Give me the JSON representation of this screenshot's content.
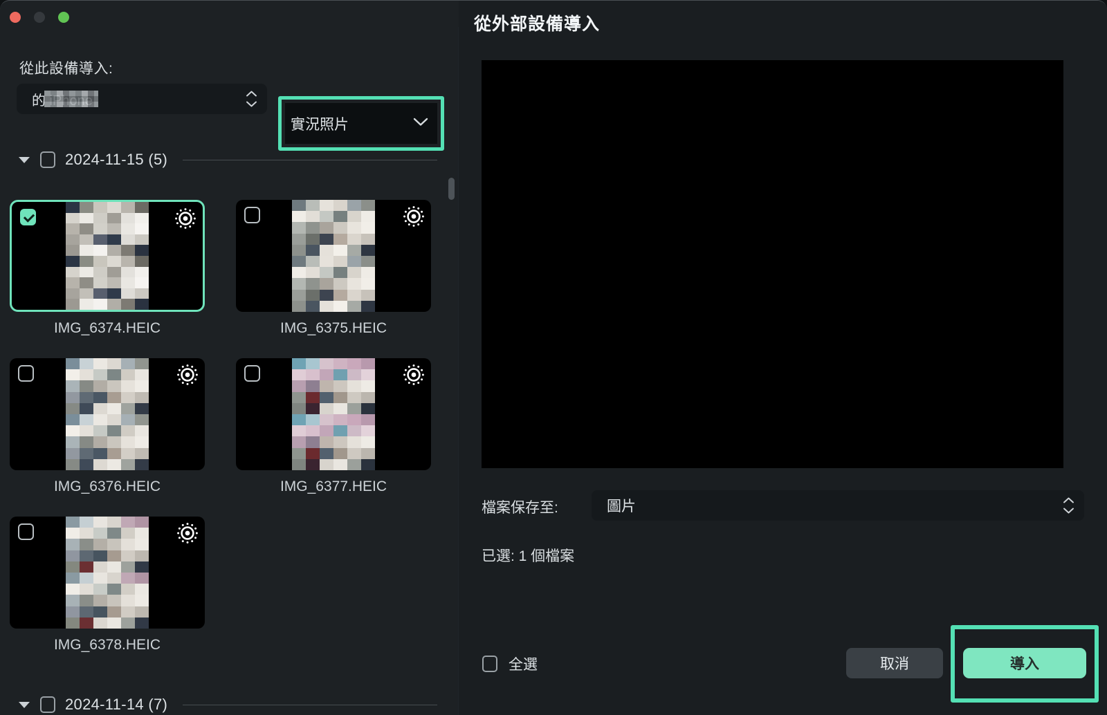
{
  "window": {
    "traffic_lights": [
      {
        "name": "close",
        "color": "#ee6a5f"
      },
      {
        "name": "minimize",
        "color": "#35393d"
      },
      {
        "name": "maximize",
        "color": "#61c454"
      }
    ],
    "background": "#1d2124"
  },
  "dialog": {
    "title": "從外部設備導入"
  },
  "left": {
    "source_label": "從此設備導入:",
    "device": {
      "value": "的 iPhone",
      "redacted": true,
      "stepper_icon": "stepper-up-down-icon"
    },
    "media_type": {
      "value": "實況照片",
      "chevron_icon": "chevron-down-icon",
      "highlight_color": "#54e0b4"
    },
    "groups": [
      {
        "date": "2024-11-15 (5)",
        "checked": false,
        "expanded": true,
        "disclosure_icon": "triangle-down-icon",
        "items": [
          {
            "filename": "IMG_6374.HEIC",
            "selected": true,
            "badge_icon": "live-photo-icon"
          },
          {
            "filename": "IMG_6375.HEIC",
            "selected": false,
            "badge_icon": "live-photo-icon"
          },
          {
            "filename": "IMG_6376.HEIC",
            "selected": false,
            "badge_icon": "live-photo-icon"
          },
          {
            "filename": "IMG_6377.HEIC",
            "selected": false,
            "badge_icon": "live-photo-icon"
          },
          {
            "filename": "IMG_6378.HEIC",
            "selected": false,
            "badge_icon": "live-photo-icon"
          }
        ]
      },
      {
        "date": "2024-11-14 (7)",
        "checked": false,
        "expanded": true,
        "disclosure_icon": "triangle-down-icon",
        "items": []
      }
    ],
    "scrollbar": {
      "name": "vertical-scrollbar"
    }
  },
  "right": {
    "preview": {
      "name": "preview-area",
      "color": "#000000"
    },
    "save_to_label": "檔案保存至:",
    "save_to_value": "圖片",
    "save_to_stepper_icon": "stepper-up-down-icon",
    "selected_count_text": "已選: 1 個檔案",
    "select_all_label": "全選",
    "select_all_checked": false,
    "cancel_label": "取消",
    "import_label": "導入",
    "import_highlight_color": "#54e0b4",
    "import_button_color": "#7fe6c0"
  },
  "thumbnail_pixels": {
    "IMG_6374.HEIC": [
      "#2b3544",
      "#8a8c84",
      "#c9c6bd",
      "#dcd9d2",
      "#b9b5ad",
      "#6c6a63",
      "#d6d3cc",
      "#eceae5",
      "#cfcdc6",
      "#a09d96",
      "#e3e1dc",
      "#f2f0ec",
      "#b7b3ab",
      "#8f8d86",
      "#d2d0c9",
      "#bdbab3",
      "#e9e7e2",
      "#f6f4f1",
      "#a7a49d",
      "#c2bfb8",
      "#585f6e",
      "#2f3a4a",
      "#dedcd7",
      "#cbc8c1",
      "#9c9992",
      "#edebe6",
      "#f4f2ef",
      "#b1aea7",
      "#7d7a73",
      "#2a3240"
    ],
    "IMG_6375.HEIC": [
      "#6f7a7f",
      "#b9bdb8",
      "#e6e2db",
      "#d9d4cc",
      "#9aa3a8",
      "#8b8f8a",
      "#f0ede7",
      "#e2ded7",
      "#c4c8c3",
      "#76807f",
      "#d8d4cc",
      "#efece6",
      "#b3b7b2",
      "#8f938e",
      "#a9a49c",
      "#cdc9c1",
      "#e8e4dd",
      "#f1eee8",
      "#9a9e99",
      "#6b6f6a",
      "#3d4450",
      "#b5aa9f",
      "#dad5cd",
      "#c7c2ba",
      "#8d918c",
      "#4a5560",
      "#e5e1da",
      "#f3f0ea",
      "#a6aaa5",
      "#2e3642"
    ],
    "IMG_6376.HEIC": [
      "#7a8e9a",
      "#c8d2d6",
      "#ebe8e2",
      "#dcd8d1",
      "#a6b0b5",
      "#91958f",
      "#f2efe9",
      "#e4e0d9",
      "#c6cac5",
      "#7d8786",
      "#d0ccc4",
      "#e9e6e0",
      "#aab4b8",
      "#868a85",
      "#b2ada5",
      "#cac6be",
      "#e6e2db",
      "#efece6",
      "#9298a0",
      "#5f6a74",
      "#4a5764",
      "#a89d92",
      "#d3cec6",
      "#c0bbb3",
      "#868a85",
      "#3f4a58",
      "#ddd9d2",
      "#ece9e3",
      "#9fa39e",
      "#333b47"
    ],
    "IMG_6377.HEIC": [
      "#6fa3b4",
      "#a8c6d0",
      "#d6c2cc",
      "#cfb3c2",
      "#c9a8bb",
      "#b899ad",
      "#e0cdd6",
      "#d8c0cd",
      "#c2a6b8",
      "#70a0b0",
      "#cdbac6",
      "#e3d2da",
      "#b89fb0",
      "#8e7f91",
      "#bfb5ad",
      "#cdc7bf",
      "#e5e1da",
      "#eeebe5",
      "#8f958f",
      "#6b2a2e",
      "#52606e",
      "#a1978c",
      "#cec9c1",
      "#bbb6ae",
      "#7f8580",
      "#3a2430",
      "#d8d4cd",
      "#e9e6e0",
      "#9ba09b",
      "#2a323d"
    ],
    "IMG_6378.HEIC": [
      "#8a9aa2",
      "#c5cfd3",
      "#e8e5df",
      "#d8d4cd",
      "#c0a8b5",
      "#b094a4",
      "#f0ede7",
      "#e1ddd6",
      "#c8ccc7",
      "#7f8988",
      "#d2cec6",
      "#ebe8e2",
      "#a8b2b6",
      "#8a8e89",
      "#b4afa7",
      "#c8c4bc",
      "#e4e0d9",
      "#edeae4",
      "#9096a0",
      "#5d6872",
      "#47545f",
      "#a69b90",
      "#d1ccc4",
      "#bdb8b0",
      "#84887f",
      "#6b2f32",
      "#dbd7d0",
      "#eae7e1",
      "#9da19c",
      "#313946"
    ]
  }
}
